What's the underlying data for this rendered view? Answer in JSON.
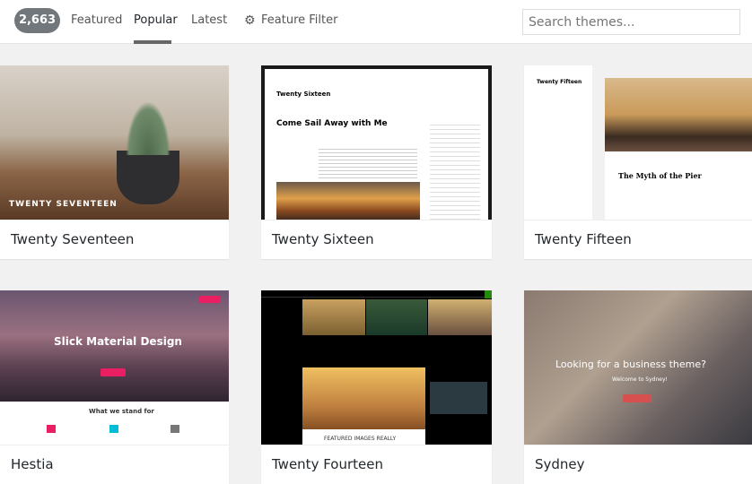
{
  "header": {
    "theme_count": "2,663",
    "tabs": [
      {
        "label": "Featured"
      },
      {
        "label": "Popular",
        "active": true
      },
      {
        "label": "Latest"
      }
    ],
    "feature_filter": "Feature Filter",
    "search_placeholder": "Search themes..."
  },
  "themes": [
    {
      "name": "Twenty Seventeen",
      "preview": {
        "title": "TWENTY SEVENTEEN"
      }
    },
    {
      "name": "Twenty Sixteen",
      "preview": {
        "title": "Twenty Sixteen",
        "post": "Come Sail Away with Me"
      }
    },
    {
      "name": "Twenty Fifteen",
      "preview": {
        "title": "Twenty Fifteen",
        "post": "The Myth of the Pier"
      }
    },
    {
      "name": "Hestia",
      "preview": {
        "title": "Slick Material Design",
        "section": "What we stand for"
      }
    },
    {
      "name": "Twenty Fourteen",
      "preview": {
        "caption": "FEATURED IMAGES REALLY"
      }
    },
    {
      "name": "Sydney",
      "preview": {
        "title": "Looking for a business theme?",
        "subtitle": "Welcome to Sydney!"
      }
    }
  ],
  "colors": {
    "accent": "#72777c",
    "hestia_pink": "#e91e63"
  }
}
